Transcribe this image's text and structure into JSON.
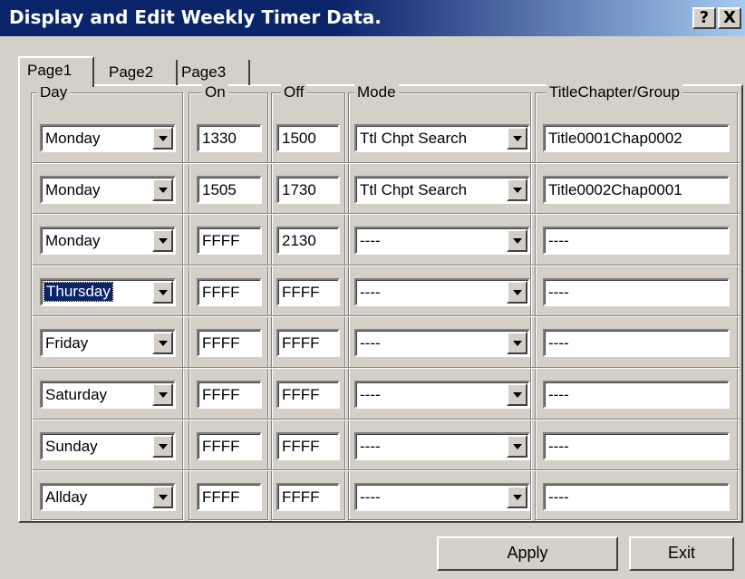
{
  "window": {
    "title": "Display and Edit Weekly Timer Data."
  },
  "titlebar_buttons": {
    "help": "?",
    "close": "X"
  },
  "tabs": [
    "Page1",
    "Page2",
    "Page3"
  ],
  "columns": {
    "day": "Day",
    "on": "On",
    "off": "Off",
    "mode": "Mode",
    "title": "TitleChapter/Group"
  },
  "rows": [
    {
      "day": "Monday",
      "on": "1330",
      "off": "1500",
      "mode": "Ttl Chpt Search",
      "title": "Title0001Chap0002"
    },
    {
      "day": "Monday",
      "on": "1505",
      "off": "1730",
      "mode": "Ttl Chpt Search",
      "title": "Title0002Chap0001"
    },
    {
      "day": "Monday",
      "on": "FFFF",
      "off": "2130",
      "mode": "----",
      "title": "----"
    },
    {
      "day": "Thursday",
      "on": "FFFF",
      "off": "FFFF",
      "mode": "----",
      "title": "----"
    },
    {
      "day": "Friday",
      "on": "FFFF",
      "off": "FFFF",
      "mode": "----",
      "title": "----"
    },
    {
      "day": "Saturday",
      "on": "FFFF",
      "off": "FFFF",
      "mode": "----",
      "title": "----"
    },
    {
      "day": "Sunday",
      "on": "FFFF",
      "off": "FFFF",
      "mode": "----",
      "title": "----"
    },
    {
      "day": "Allday",
      "on": "FFFF",
      "off": "FFFF",
      "mode": "----",
      "title": "----"
    }
  ],
  "focused_row": 3,
  "buttons": {
    "apply": "Apply",
    "exit": "Exit"
  },
  "colors": {
    "titlebar_start": "#0a246a",
    "titlebar_end": "#a6caf0",
    "dialog_face": "#d4d0c8",
    "selection": "#0a246a"
  }
}
